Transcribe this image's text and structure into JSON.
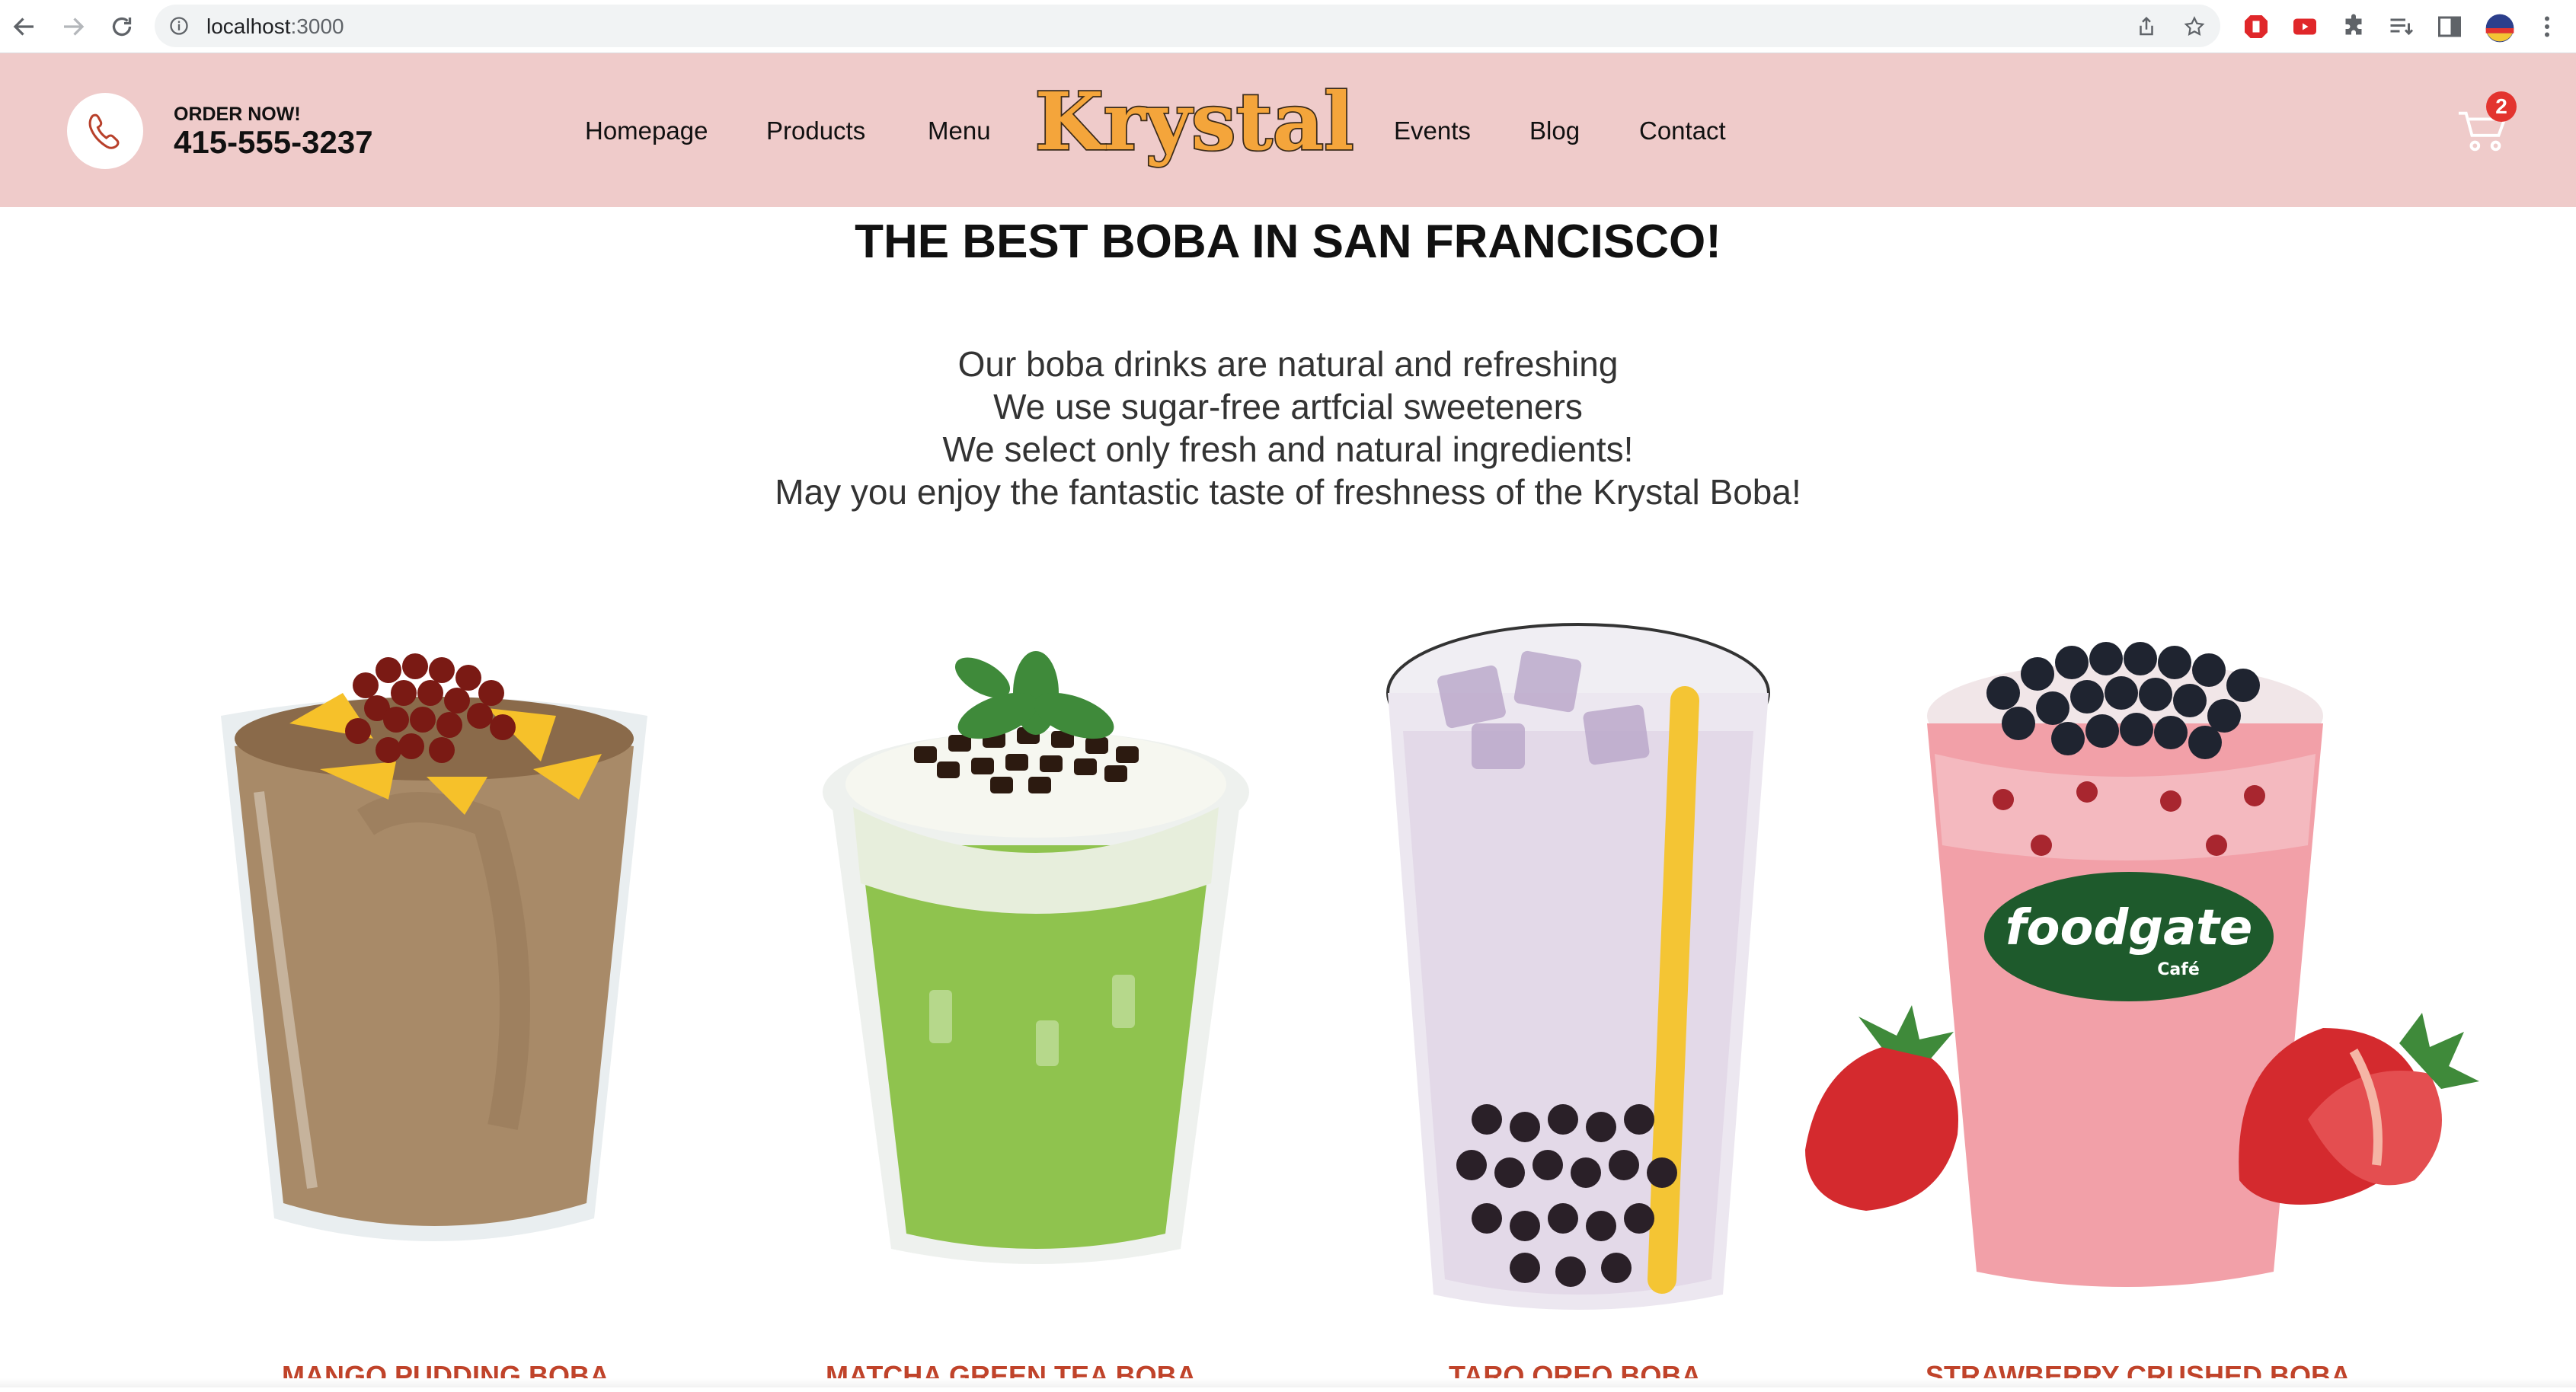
{
  "browser": {
    "url_host": "localhost",
    "url_port": ":3000",
    "icons": [
      "back-icon",
      "forward-icon",
      "reload-icon",
      "site-info-icon",
      "share-icon",
      "bookmark-star-icon",
      "adblock-extension-icon",
      "youtube-extension-icon",
      "extensions-puzzle-icon",
      "reading-list-icon",
      "side-panel-icon",
      "profile-avatar",
      "more-menu-icon"
    ]
  },
  "header": {
    "order_label": "ORDER NOW!",
    "phone": "415-555-3237",
    "nav_left": [
      "Homepage",
      "Products",
      "Menu"
    ],
    "logo_text": "Krystal",
    "nav_right": [
      "Events",
      "Blog",
      "Contact"
    ],
    "cart_count": "2",
    "background_color": "#efcbca"
  },
  "hero": {
    "title": "THE BEST BOBA IN SAN FRANCISCO!",
    "lines": [
      "Our boba drinks are natural and refreshing",
      "We use sugar-free artfcial sweeteners",
      "We select only fresh and natural ingredients!",
      "May you enjoy the fantastic taste of freshness of the Krystal Boba!"
    ]
  },
  "products": [
    {
      "name": "MANGO PUDDING BOBA",
      "drink_color": "#a88a68"
    },
    {
      "name": "MATCHA GREEN TEA BOBA",
      "drink_color": "#8fc34e"
    },
    {
      "name": "TARO OREO BOBA",
      "drink_color": "#e3d9e8"
    },
    {
      "name": "STRAWBERRY CRUSHED BOBA",
      "drink_color": "#f2a0a8",
      "cup_logo": "foodgate",
      "cup_logo_sub": "Café"
    }
  ],
  "colors": {
    "accent": "#c0432a",
    "badge": "#e3342f",
    "logo_fill": "#f4a53b"
  }
}
